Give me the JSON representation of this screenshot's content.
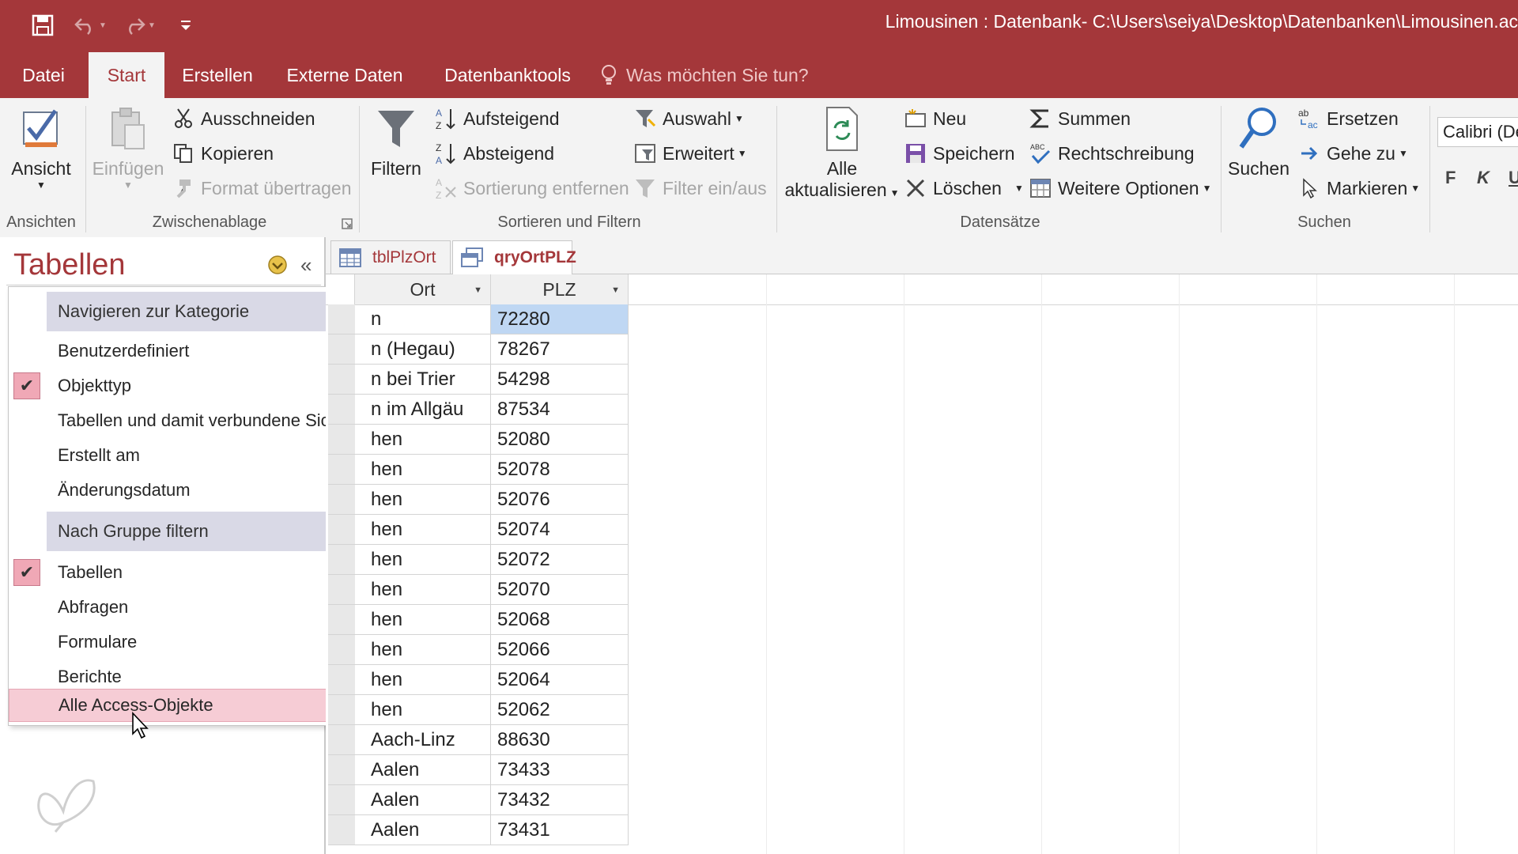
{
  "titlebar": {
    "title": "Limousinen : Datenbank- C:\\Users\\seiya\\Desktop\\Datenbanken\\Limousinen.ac",
    "bg_color": "#a4373a"
  },
  "tabs": [
    {
      "label": "Datei"
    },
    {
      "label": "Start"
    },
    {
      "label": "Erstellen"
    },
    {
      "label": "Externe Daten"
    },
    {
      "label": "Datenbanktools"
    }
  ],
  "tell_me": "Was möchten Sie tun?",
  "ribbon": {
    "ansichten": {
      "view_label": "Ansicht",
      "group_label": "Ansichten"
    },
    "zwischenablage": {
      "paste_label": "Einfügen",
      "cut_label": "Ausschneiden",
      "copy_label": "Kopieren",
      "format_label": "Format übertragen",
      "group_label": "Zwischenablage"
    },
    "sortieren": {
      "filter_label": "Filtern",
      "asc_label": "Aufsteigend",
      "desc_label": "Absteigend",
      "remove_sort_label": "Sortierung entfernen",
      "selection_label": "Auswahl",
      "advanced_label": "Erweitert",
      "toggle_filter_label": "Filter ein/aus",
      "group_label": "Sortieren und Filtern"
    },
    "datensaetze": {
      "refresh_line1": "Alle",
      "refresh_line2": "aktualisieren",
      "new_label": "Neu",
      "save_label": "Speichern",
      "delete_label": "Löschen",
      "sum_label": "Summen",
      "spelling_label": "Rechtschreibung",
      "more_label": "Weitere Optionen",
      "group_label": "Datensätze"
    },
    "suchen": {
      "find_label": "Suchen",
      "replace_label": "Ersetzen",
      "goto_label": "Gehe zu",
      "select_label": "Markieren",
      "group_label": "Suchen"
    },
    "font": {
      "name": "Calibri (De",
      "bold": "F",
      "italic": "K",
      "underline": "U"
    }
  },
  "nav": {
    "title": "Tabellen",
    "menu": {
      "header1": "Navigieren zur Kategorie",
      "category_items": [
        {
          "label": "Benutzerdefiniert",
          "checked": false
        },
        {
          "label": "Objekttyp",
          "checked": true
        },
        {
          "label": "Tabellen und damit verbundene Sichten",
          "checked": false
        },
        {
          "label": "Erstellt am",
          "checked": false
        },
        {
          "label": "Änderungsdatum",
          "checked": false
        }
      ],
      "header2": "Nach Gruppe filtern",
      "group_items": [
        {
          "label": "Tabellen",
          "checked": true
        },
        {
          "label": "Abfragen",
          "checked": false
        },
        {
          "label": "Formulare",
          "checked": false
        },
        {
          "label": "Berichte",
          "checked": false
        },
        {
          "label": "Alle Access-Objekte",
          "checked": false
        }
      ]
    }
  },
  "doc_tabs": [
    {
      "label": "tblPlzOrt",
      "active": false
    },
    {
      "label": "qryOrtPLZ",
      "active": true
    }
  ],
  "datasheet": {
    "columns": [
      "Ort",
      "PLZ"
    ],
    "rows": [
      {
        "ort": "n",
        "plz": "72280"
      },
      {
        "ort": "n (Hegau)",
        "plz": "78267"
      },
      {
        "ort": "n bei Trier",
        "plz": "54298"
      },
      {
        "ort": "n im Allgäu",
        "plz": "87534"
      },
      {
        "ort": "hen",
        "plz": "52080"
      },
      {
        "ort": "hen",
        "plz": "52078"
      },
      {
        "ort": "hen",
        "plz": "52076"
      },
      {
        "ort": "hen",
        "plz": "52074"
      },
      {
        "ort": "hen",
        "plz": "52072"
      },
      {
        "ort": "hen",
        "plz": "52070"
      },
      {
        "ort": "hen",
        "plz": "52068"
      },
      {
        "ort": "hen",
        "plz": "52066"
      },
      {
        "ort": "hen",
        "plz": "52064"
      },
      {
        "ort": "hen",
        "plz": "52062"
      },
      {
        "ort": "Aach-Linz",
        "plz": "88630"
      },
      {
        "ort": "Aalen",
        "plz": "73433"
      },
      {
        "ort": "Aalen",
        "plz": "73432"
      },
      {
        "ort": "Aalen",
        "plz": "73431"
      }
    ],
    "selected_row": 0
  }
}
